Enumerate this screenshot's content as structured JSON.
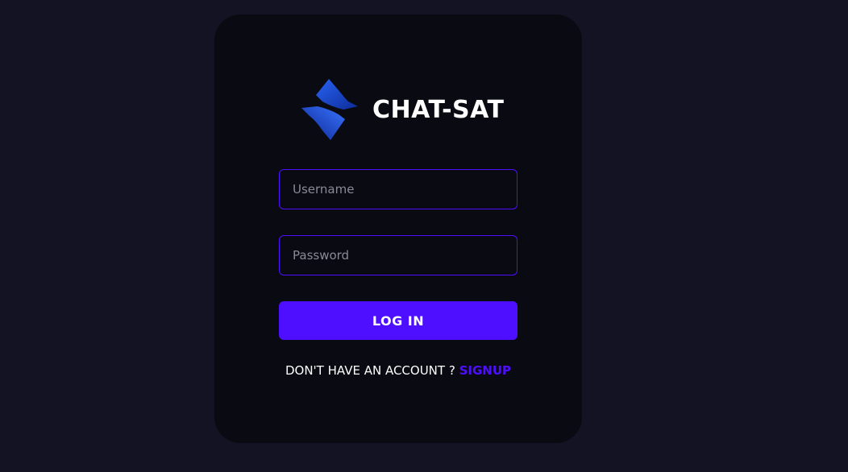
{
  "brand": {
    "name": "CHAT-SAT",
    "logo_icon": "diamond-s-logo",
    "logo_color": "#1a4fd6"
  },
  "form": {
    "username_placeholder": "Username",
    "password_placeholder": "Password",
    "login_label": "LOG IN",
    "signup_prompt": "DON'T HAVE AN ACCOUNT ? ",
    "signup_link": "SIGNUP"
  },
  "colors": {
    "background": "#131324",
    "card": "#0a0a12",
    "accent": "#4e0eff"
  }
}
